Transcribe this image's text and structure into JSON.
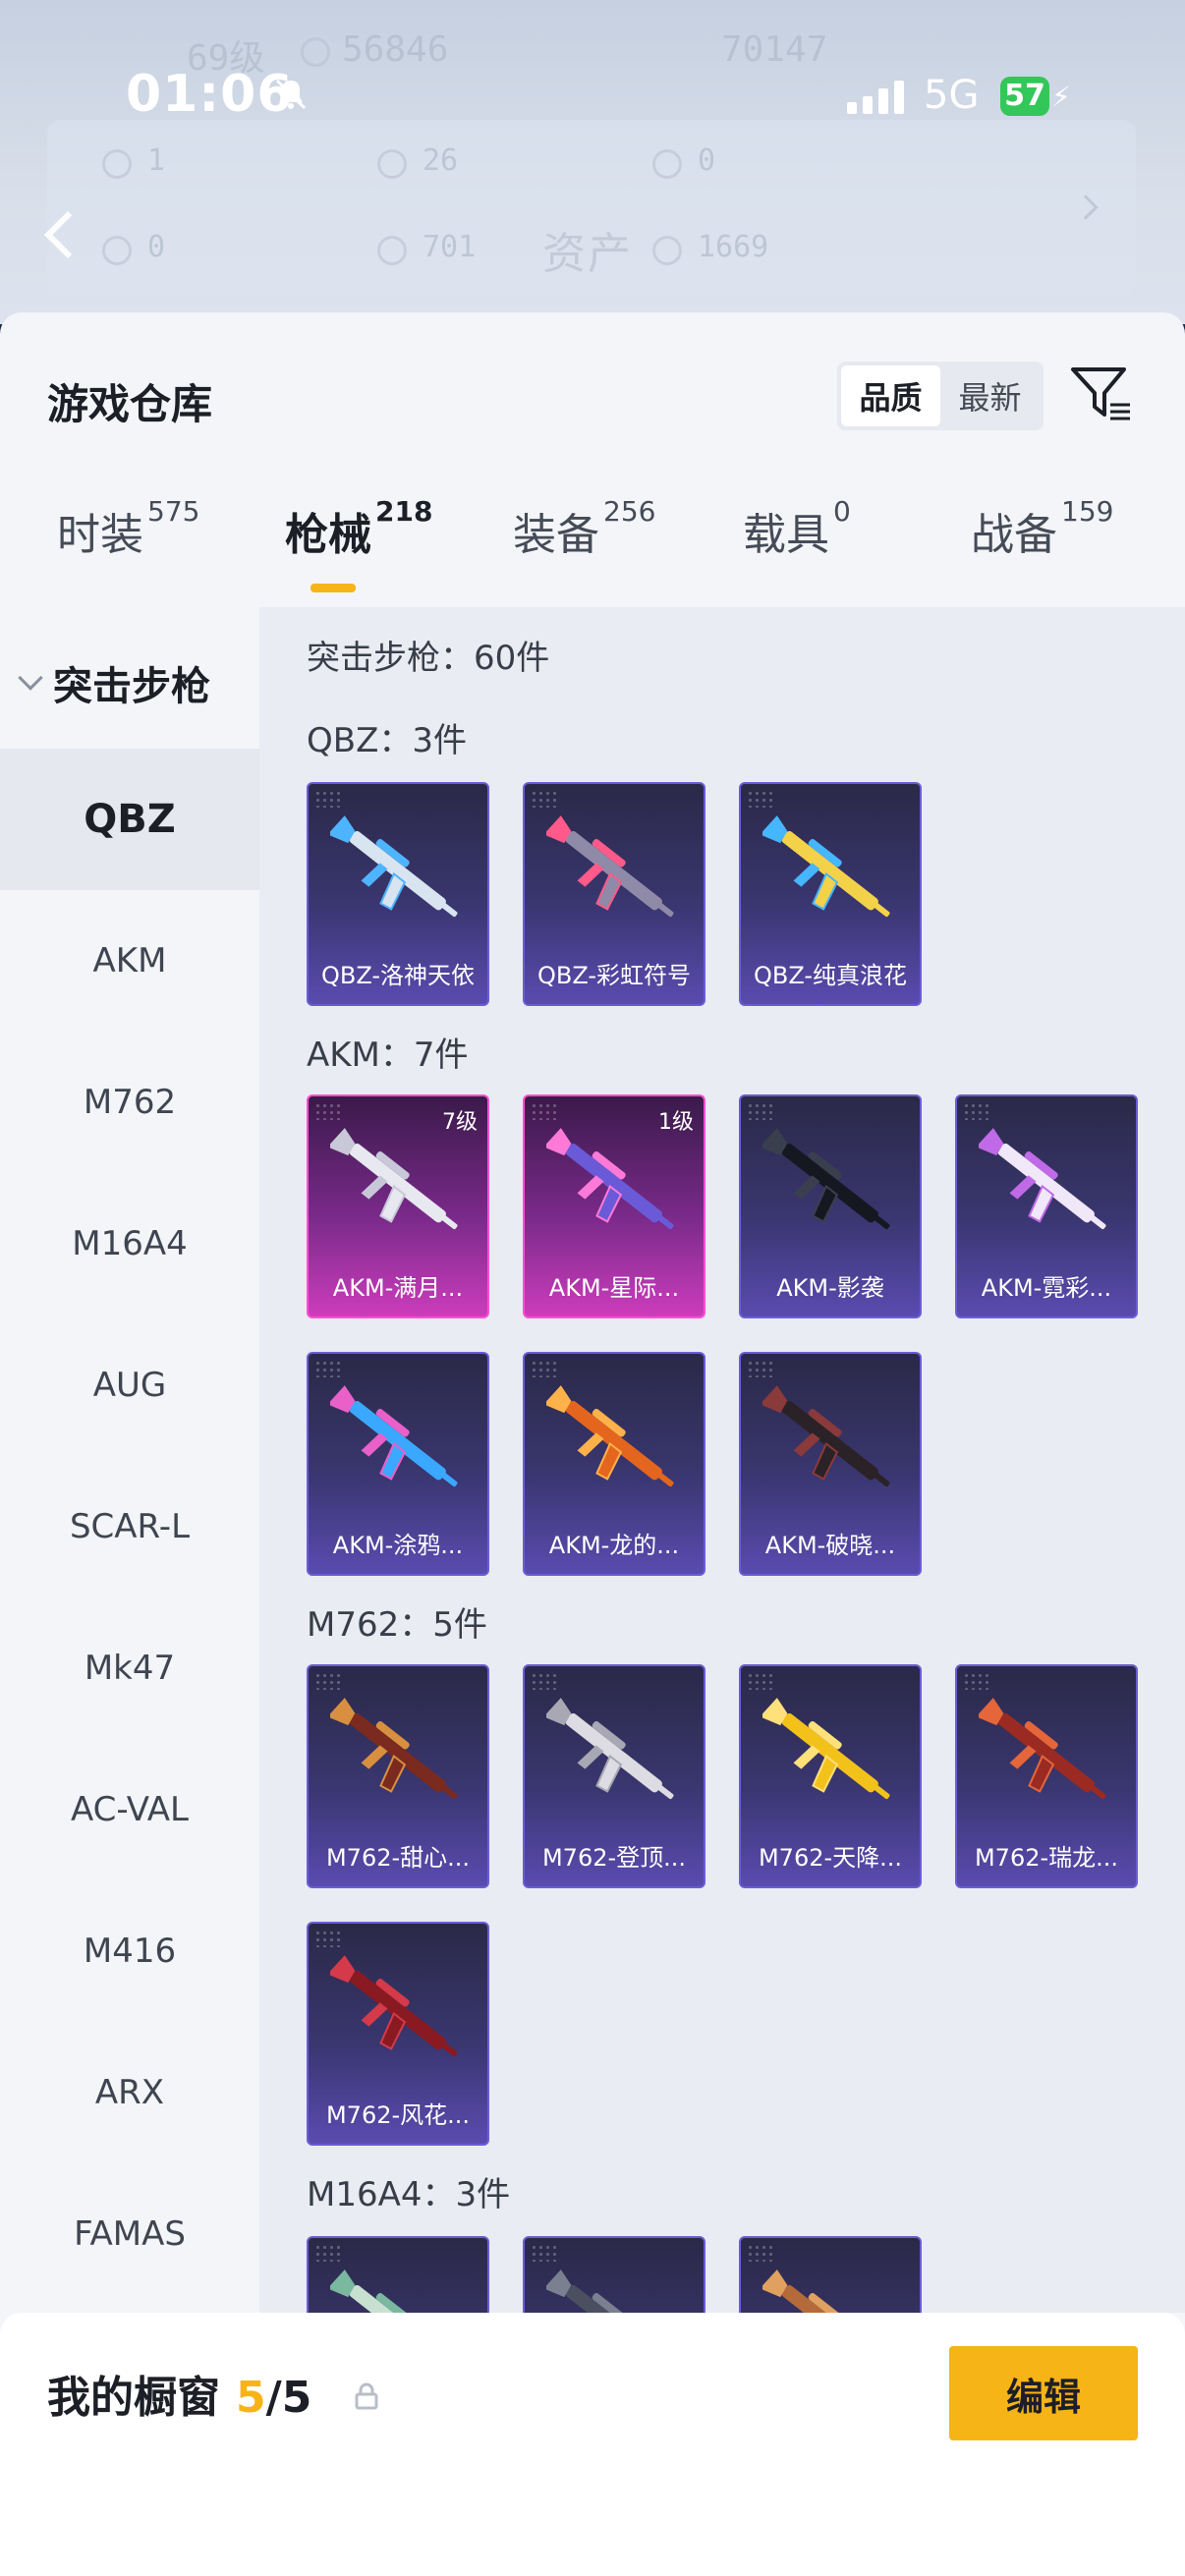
{
  "status": {
    "time": "01:06",
    "network": "5G",
    "battery": "57"
  },
  "background": {
    "level": "69级",
    "coins": "56846",
    "score": "70147",
    "row1": [
      "1",
      "26",
      "0"
    ],
    "row2": [
      "0",
      "701",
      "1669"
    ],
    "title": "资产"
  },
  "header": {
    "title": "游戏仓库",
    "sort": [
      "品质",
      "最新"
    ]
  },
  "tabs": [
    {
      "label": "时装",
      "count": "575"
    },
    {
      "label": "枪械",
      "count": "218"
    },
    {
      "label": "装备",
      "count": "256"
    },
    {
      "label": "载具",
      "count": "0"
    },
    {
      "label": "战备",
      "count": "159"
    }
  ],
  "sidebar": {
    "group": "突击步枪",
    "items": [
      "QBZ",
      "AKM",
      "M762",
      "M16A4",
      "AUG",
      "SCAR-L",
      "Mk47",
      "AC-VAL",
      "M416",
      "ARX",
      "FAMAS"
    ]
  },
  "content": {
    "summary": "突击步枪：60件",
    "sections": [
      {
        "title": "QBZ：3件",
        "cards": [
          {
            "name": "QBZ-洛神天依",
            "level": "",
            "rarity": "purple",
            "gun_color": "#d8e4f0",
            "accent": "#4fb4ff"
          },
          {
            "name": "QBZ-彩虹符号",
            "level": "",
            "rarity": "purple",
            "gun_color": "#8e8aa8",
            "accent": "#ff5a8a"
          },
          {
            "name": "QBZ-纯真浪花",
            "level": "",
            "rarity": "purple",
            "gun_color": "#f3d24a",
            "accent": "#46b6ff"
          }
        ]
      },
      {
        "title": "AKM：7件",
        "cards": [
          {
            "name": "AKM-满月...",
            "level": "7级",
            "rarity": "pink",
            "gun_color": "#e8e8f0",
            "accent": "#c8c8d8"
          },
          {
            "name": "AKM-星际...",
            "level": "1级",
            "rarity": "pink",
            "gun_color": "#6a5ad8",
            "accent": "#ff7ad8"
          },
          {
            "name": "AKM-影袭",
            "level": "",
            "rarity": "purple",
            "gun_color": "#151821",
            "accent": "#3a3f4e"
          },
          {
            "name": "AKM-霓彩...",
            "level": "",
            "rarity": "purple",
            "gun_color": "#f0e8f8",
            "accent": "#c06ae8"
          },
          {
            "name": "AKM-涂鸦...",
            "level": "",
            "rarity": "purple",
            "gun_color": "#3aa8ff",
            "accent": "#e860c8"
          },
          {
            "name": "AKM-龙的...",
            "level": "",
            "rarity": "purple",
            "gun_color": "#e4661e",
            "accent": "#ffb24a"
          },
          {
            "name": "AKM-破晓...",
            "level": "",
            "rarity": "purple",
            "gun_color": "#2a2226",
            "accent": "#8a3a3a"
          }
        ]
      },
      {
        "title": "M762：5件",
        "cards": [
          {
            "name": "M762-甜心...",
            "level": "",
            "rarity": "purple",
            "gun_color": "#7a2a1e",
            "accent": "#d89040"
          },
          {
            "name": "M762-登顶...",
            "level": "",
            "rarity": "purple",
            "gun_color": "#dcdce2",
            "accent": "#a8a8b4"
          },
          {
            "name": "M762-天降...",
            "level": "",
            "rarity": "purple",
            "gun_color": "#f3c21a",
            "accent": "#ffe07a"
          },
          {
            "name": "M762-瑞龙...",
            "level": "",
            "rarity": "purple",
            "gun_color": "#9a2a22",
            "accent": "#e4663a"
          },
          {
            "name": "M762-风花...",
            "level": "",
            "rarity": "purple",
            "gun_color": "#8a1a22",
            "accent": "#d43a4a"
          }
        ]
      },
      {
        "title": "M16A4：3件",
        "cards": [
          {
            "name": "",
            "level": "",
            "rarity": "purple",
            "gun_color": "#c8e0d0",
            "accent": "#7ab8a0"
          },
          {
            "name": "",
            "level": "",
            "rarity": "purple",
            "gun_color": "#4a5060",
            "accent": "#7a8090"
          },
          {
            "name": "",
            "level": "",
            "rarity": "purple",
            "gun_color": "#b46a3a",
            "accent": "#e0a060"
          }
        ]
      }
    ]
  },
  "showcase": {
    "title": "我的橱窗",
    "count": "5",
    "total": "/5",
    "edit_label": "编辑"
  }
}
